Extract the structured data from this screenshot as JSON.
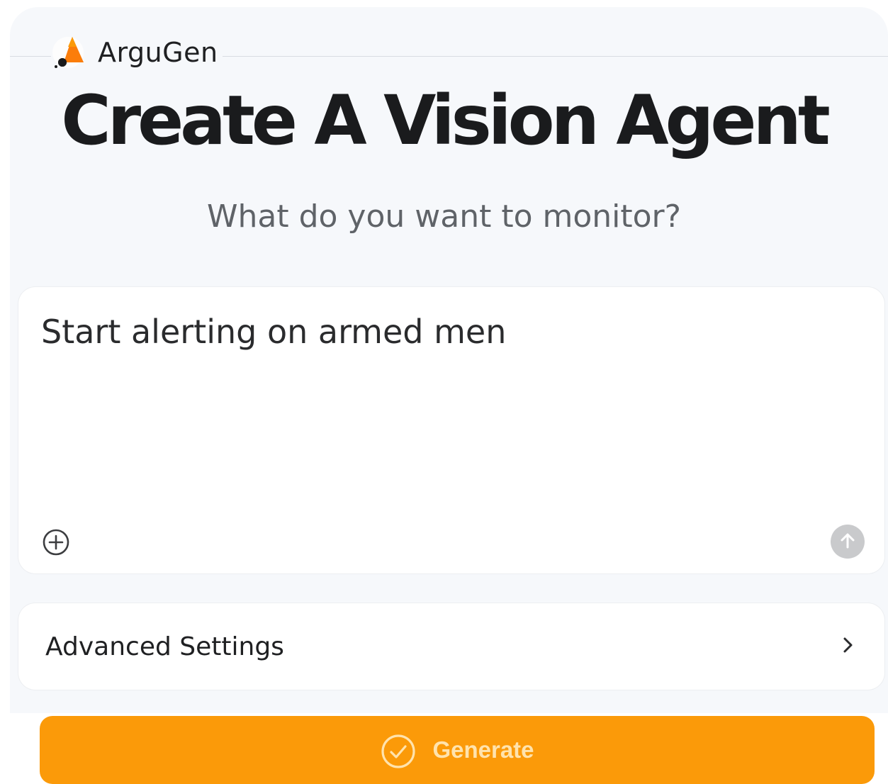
{
  "app": {
    "brand_name": "ArguGen",
    "logo_icon": "argugen-logo-icon"
  },
  "hero": {
    "title": "Create A Vision Agent",
    "subtitle": "What do you want to monitor?"
  },
  "prompt": {
    "value": "Start alerting on armed men",
    "attach_icon": "plus-circle-icon",
    "send_icon": "arrow-up-icon"
  },
  "advanced_settings": {
    "label": "Advanced Settings",
    "icon": "chevron-right-icon"
  },
  "generate": {
    "label": "Generate",
    "icon": "check-circle-icon"
  },
  "colors": {
    "accent": "#fb9a09",
    "background": "#f6f8fb",
    "title_text": "#1a1b1d",
    "subtitle_text": "#5f6368",
    "send_disabled": "#c9cacc"
  }
}
